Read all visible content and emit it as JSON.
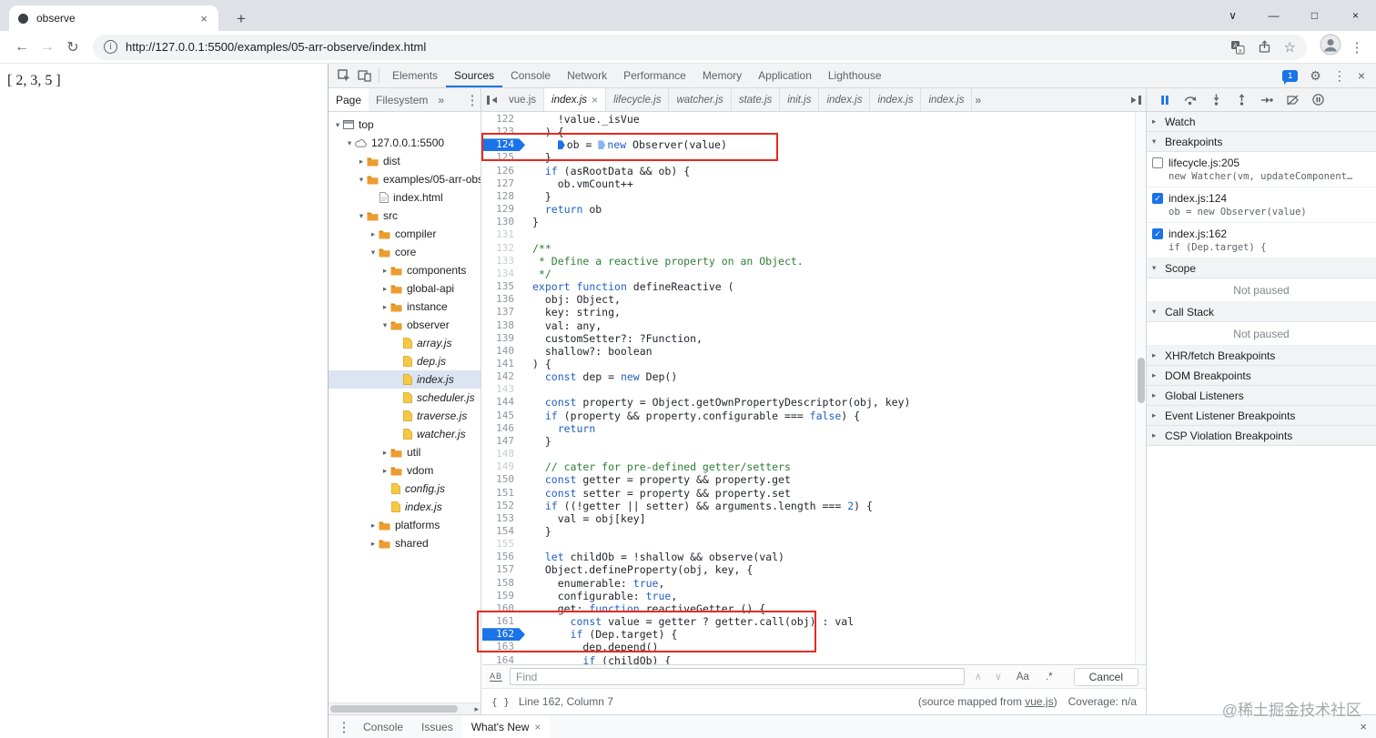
{
  "window": {
    "tab_title": "observe",
    "url": "http://127.0.0.1:5500/examples/05-arr-observe/index.html",
    "page_text": "[ 2, 3, 5 ]"
  },
  "icons": {
    "kebab": "⋮",
    "gear": "⚙",
    "close": "×",
    "chevron_down": "∨",
    "minimize": "—",
    "maximize": "□",
    "star": "☆",
    "back": "←",
    "forward": "→",
    "reload": "↻",
    "plus": "+",
    "overflow": "»",
    "up": "∧",
    "down": "∨",
    "tri_open": "▾",
    "tri_closed": "▸",
    "pretty_print": "{ }",
    "find": "AB",
    "info": "i",
    "check": "✓"
  },
  "devtools": {
    "issues_count": "1",
    "panel_tabs": [
      {
        "label": "Elements",
        "active": false
      },
      {
        "label": "Sources",
        "active": true
      },
      {
        "label": "Console",
        "active": false
      },
      {
        "label": "Network",
        "active": false
      },
      {
        "label": "Performance",
        "active": false
      },
      {
        "label": "Memory",
        "active": false
      },
      {
        "label": "Application",
        "active": false
      },
      {
        "label": "Lighthouse",
        "active": false
      }
    ],
    "navigator": {
      "tabs": [
        {
          "label": "Page",
          "active": true
        },
        {
          "label": "Filesystem",
          "active": false
        }
      ],
      "overflow": "»",
      "tree": [
        {
          "label": "top",
          "depth": 0,
          "type": "frame",
          "state": "expanded"
        },
        {
          "label": "127.0.0.1:5500",
          "depth": 1,
          "type": "cloud",
          "state": "expanded"
        },
        {
          "label": "dist",
          "depth": 2,
          "type": "folder",
          "state": "collapsed"
        },
        {
          "label": "examples/05-arr-observe",
          "depth": 2,
          "type": "folder",
          "state": "expanded"
        },
        {
          "label": "index.html",
          "depth": 3,
          "type": "file-html"
        },
        {
          "label": "src",
          "depth": 2,
          "type": "folder",
          "state": "expanded"
        },
        {
          "label": "compiler",
          "depth": 3,
          "type": "folder",
          "state": "collapsed"
        },
        {
          "label": "core",
          "depth": 3,
          "type": "folder",
          "state": "expanded"
        },
        {
          "label": "components",
          "depth": 4,
          "type": "folder",
          "state": "collapsed"
        },
        {
          "label": "global-api",
          "depth": 4,
          "type": "folder",
          "state": "collapsed"
        },
        {
          "label": "instance",
          "depth": 4,
          "type": "folder",
          "state": "collapsed"
        },
        {
          "label": "observer",
          "depth": 4,
          "type": "folder",
          "state": "expanded"
        },
        {
          "label": "array.js",
          "depth": 5,
          "type": "file-js",
          "italic": true
        },
        {
          "label": "dep.js",
          "depth": 5,
          "type": "file-js",
          "italic": true
        },
        {
          "label": "index.js",
          "depth": 5,
          "type": "file-js",
          "italic": true,
          "selected": true
        },
        {
          "label": "scheduler.js",
          "depth": 5,
          "type": "file-js",
          "italic": true
        },
        {
          "label": "traverse.js",
          "depth": 5,
          "type": "file-js",
          "italic": true
        },
        {
          "label": "watcher.js",
          "depth": 5,
          "type": "file-js",
          "italic": true
        },
        {
          "label": "util",
          "depth": 4,
          "type": "folder",
          "state": "collapsed"
        },
        {
          "label": "vdom",
          "depth": 4,
          "type": "folder",
          "state": "collapsed"
        },
        {
          "label": "config.js",
          "depth": 4,
          "type": "file-js",
          "italic": true
        },
        {
          "label": "index.js",
          "depth": 4,
          "type": "file-js",
          "italic": true
        },
        {
          "label": "platforms",
          "depth": 3,
          "type": "folder",
          "state": "collapsed"
        },
        {
          "label": "shared",
          "depth": 3,
          "type": "folder",
          "state": "collapsed"
        }
      ]
    },
    "editor": {
      "file_tabs": [
        {
          "label": "vue.js"
        },
        {
          "label": "index.js",
          "active": true,
          "closable": true,
          "italic": true
        },
        {
          "label": "lifecycle.js",
          "italic": true
        },
        {
          "label": "watcher.js",
          "italic": true
        },
        {
          "label": "state.js",
          "italic": true
        },
        {
          "label": "init.js",
          "italic": true
        },
        {
          "label": "index.js",
          "italic": true
        },
        {
          "label": "index.js",
          "italic": true
        },
        {
          "label": "index.js",
          "italic": true
        }
      ],
      "tabs_overflow": "»",
      "inline_markers": [
        {
          "line": 124,
          "before": "ob",
          "type": "active"
        },
        {
          "line": 124,
          "before": "new",
          "type": "candidate"
        }
      ],
      "lines": [
        {
          "num": 122,
          "text": "    !value._isVue"
        },
        {
          "num": 123,
          "text": "  ) {"
        },
        {
          "num": 124,
          "text": "    ob = new Observer(value)",
          "bp": true
        },
        {
          "num": 125,
          "text": "  }"
        },
        {
          "num": 126,
          "text": "  if (asRootData && ob) {"
        },
        {
          "num": 127,
          "text": "    ob.vmCount++"
        },
        {
          "num": 128,
          "text": "  }"
        },
        {
          "num": 129,
          "text": "  return ob"
        },
        {
          "num": 130,
          "text": "}"
        },
        {
          "num": 131,
          "text": "",
          "dim": true
        },
        {
          "num": 132,
          "text": "/**",
          "dim": true
        },
        {
          "num": 133,
          "text": " * Define a reactive property on an Object.",
          "dim": true
        },
        {
          "num": 134,
          "text": " */",
          "dim": true
        },
        {
          "num": 135,
          "text": "export function defineReactive ("
        },
        {
          "num": 136,
          "text": "  obj: Object,"
        },
        {
          "num": 137,
          "text": "  key: string,"
        },
        {
          "num": 138,
          "text": "  val: any,"
        },
        {
          "num": 139,
          "text": "  customSetter?: ?Function,"
        },
        {
          "num": 140,
          "text": "  shallow?: boolean"
        },
        {
          "num": 141,
          "text": ") {"
        },
        {
          "num": 142,
          "text": "  const dep = new Dep()"
        },
        {
          "num": 143,
          "text": "",
          "dim": true
        },
        {
          "num": 144,
          "text": "  const property = Object.getOwnPropertyDescriptor(obj, key)"
        },
        {
          "num": 145,
          "text": "  if (property && property.configurable === false) {"
        },
        {
          "num": 146,
          "text": "    return"
        },
        {
          "num": 147,
          "text": "  }"
        },
        {
          "num": 148,
          "text": "",
          "dim": true
        },
        {
          "num": 149,
          "text": "  // cater for pre-defined getter/setters",
          "dim": true
        },
        {
          "num": 150,
          "text": "  const getter = property && property.get"
        },
        {
          "num": 151,
          "text": "  const setter = property && property.set"
        },
        {
          "num": 152,
          "text": "  if ((!getter || setter) && arguments.length === 2) {"
        },
        {
          "num": 153,
          "text": "    val = obj[key]"
        },
        {
          "num": 154,
          "text": "  }"
        },
        {
          "num": 155,
          "text": "",
          "dim": true
        },
        {
          "num": 156,
          "text": "  let childOb = !shallow && observe(val)"
        },
        {
          "num": 157,
          "text": "  Object.defineProperty(obj, key, {"
        },
        {
          "num": 158,
          "text": "    enumerable: true,"
        },
        {
          "num": 159,
          "text": "    configurable: true,"
        },
        {
          "num": 160,
          "text": "    get: function reactiveGetter () {"
        },
        {
          "num": 161,
          "text": "      const value = getter ? getter.call(obj) : val"
        },
        {
          "num": 162,
          "text": "      if (Dep.target) {",
          "bp": true
        },
        {
          "num": 163,
          "text": "        dep.depend()"
        },
        {
          "num": 164,
          "text": "        if (childOb) {"
        }
      ]
    },
    "find_bar": {
      "placeholder": "Find",
      "match_case": "Aa",
      "regex": ".*",
      "cancel": "Cancel"
    },
    "status_bar": {
      "position": "Line 162, Column 7",
      "source_map_prefix": "(source mapped from ",
      "source_map_link": "vue.js",
      "source_map_suffix": ")",
      "coverage": "Coverage: n/a"
    },
    "debugger": {
      "sections": [
        {
          "label": "Watch",
          "state": "collapsed"
        },
        {
          "label": "Breakpoints",
          "state": "expanded",
          "breakpoints": [
            {
              "checked": false,
              "location": "lifecycle.js:205",
              "snippet": "new Watcher(vm, updateComponent…"
            },
            {
              "checked": true,
              "location": "index.js:124",
              "snippet": "ob = new Observer(value)"
            },
            {
              "checked": true,
              "location": "index.js:162",
              "snippet": "if (Dep.target) {"
            }
          ]
        },
        {
          "label": "Scope",
          "state": "expanded",
          "placeholder": "Not paused"
        },
        {
          "label": "Call Stack",
          "state": "expanded",
          "placeholder": "Not paused"
        },
        {
          "label": "XHR/fetch Breakpoints",
          "state": "collapsed"
        },
        {
          "label": "DOM Breakpoints",
          "state": "collapsed"
        },
        {
          "label": "Global Listeners",
          "state": "collapsed"
        },
        {
          "label": "Event Listener Breakpoints",
          "state": "collapsed"
        },
        {
          "label": "CSP Violation Breakpoints",
          "state": "collapsed"
        }
      ]
    },
    "drawer": {
      "tabs": [
        {
          "label": "Console"
        },
        {
          "label": "Issues"
        },
        {
          "label": "What's New",
          "closable": true,
          "active": true
        }
      ]
    }
  },
  "watermark": "@稀土掘金技术社区"
}
